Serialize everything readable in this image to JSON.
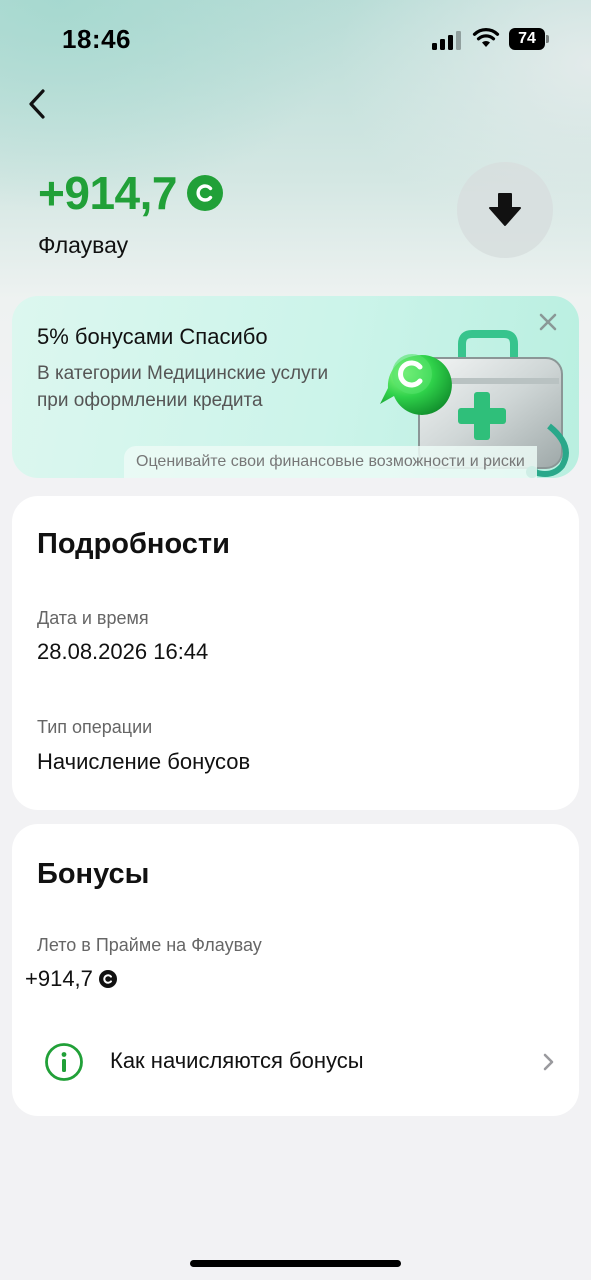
{
  "status_bar": {
    "time": "18:46",
    "battery": "74"
  },
  "header": {
    "amount": "+914,7",
    "coin_letter": "С",
    "merchant": "Флаувау"
  },
  "promo": {
    "title": "5% бонусами Спасибо",
    "description": "В категории Медицинские услуги при оформлении кредита",
    "disclaimer": "Оценивайте свои финансовые возможности и риски",
    "illustration_coin_letter": "С"
  },
  "details": {
    "title": "Подробности",
    "date_label": "Дата и время",
    "date_value": "28.08.2026 16:44",
    "type_label": "Тип операции",
    "type_value": "Начисление бонусов"
  },
  "bonuses": {
    "title": "Бонусы",
    "program_label": "Лето в Прайме на Флаувау",
    "program_value": "+914,7",
    "coin_letter": "С",
    "how_link": "Как начисляются бонусы"
  },
  "colors": {
    "accent_green": "#21a038",
    "promo_bg": "#ccf4ea",
    "page_bg": "#f2f2f4"
  },
  "icons": [
    "back-arrow-icon",
    "download-arrow-icon",
    "close-icon",
    "info-icon",
    "chevron-right-icon",
    "bonus-coin-icon",
    "signal-icon",
    "wifi-icon",
    "battery-icon"
  ]
}
